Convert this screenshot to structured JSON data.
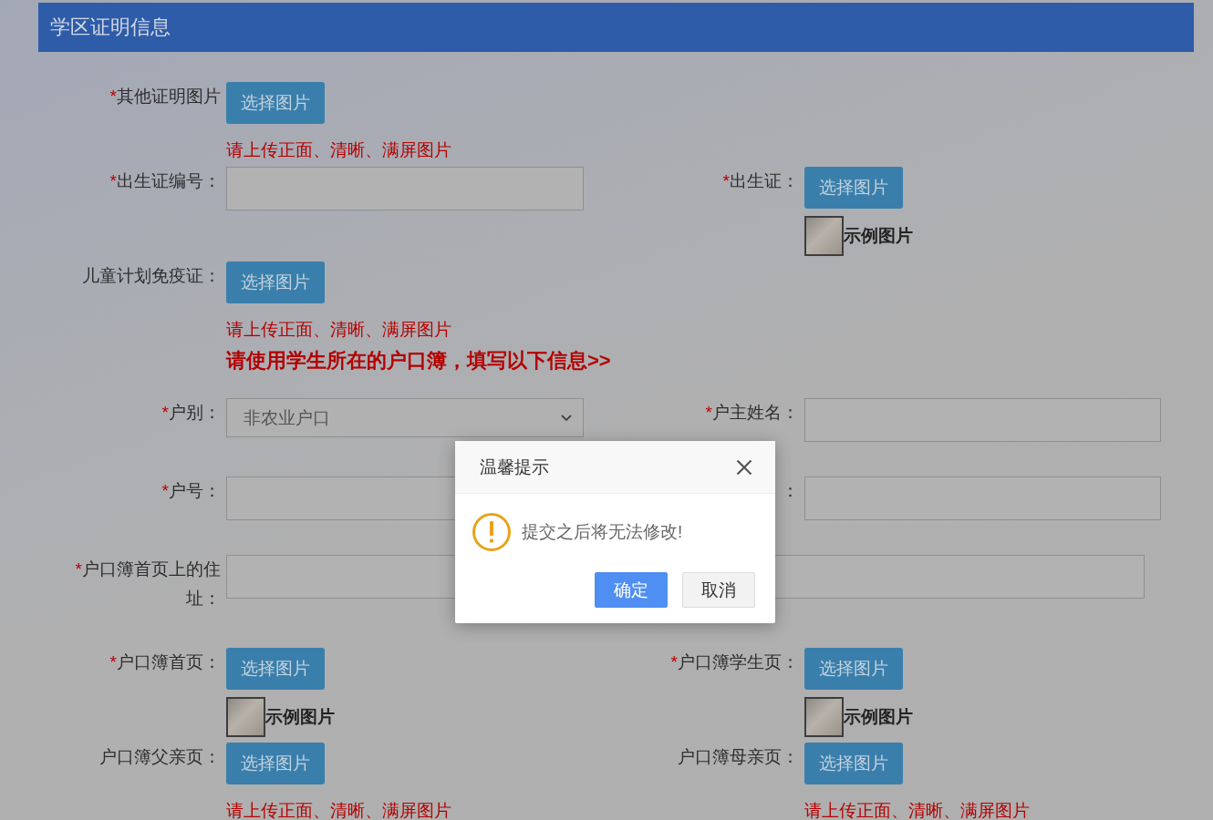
{
  "section": {
    "title": "学区证明信息"
  },
  "rows": [
    {
      "kind": "fields",
      "cells": [
        {
          "kind": "upload",
          "required_mark": "*",
          "label": "其他证明图片",
          "button": "选择图片",
          "hint": "请上传正面、清晰、满屏图片"
        }
      ]
    },
    {
      "kind": "fields",
      "cells": [
        {
          "kind": "text",
          "required_mark": "*",
          "label": "出生证编号："
        },
        {
          "kind": "upload",
          "required_mark": "*",
          "label": "出生证：",
          "button": "选择图片",
          "sample": "示例图片"
        }
      ]
    },
    {
      "kind": "fields",
      "cells": [
        {
          "kind": "upload",
          "label": "儿童计划免疫证：",
          "button": "选择图片",
          "hint": "请上传正面、清晰、满屏图片"
        }
      ]
    },
    {
      "kind": "notice",
      "text": "请使用学生所在的户口簿，填写以下信息>>"
    },
    {
      "kind": "fields",
      "cells": [
        {
          "kind": "select",
          "required_mark": "*",
          "label": "户别：",
          "value": "非农业户口"
        },
        {
          "kind": "text",
          "required_mark": "*",
          "label": "户主姓名："
        }
      ]
    },
    {
      "kind": "fields",
      "cells": [
        {
          "kind": "text",
          "required_mark": "*",
          "label": "户号："
        },
        {
          "kind": "text",
          "label": "："
        }
      ]
    },
    {
      "kind": "fields",
      "cells": [
        {
          "kind": "text",
          "required_mark": "*",
          "label": "户口簿首页上的住址："
        }
      ]
    },
    {
      "kind": "fields",
      "cells": [
        {
          "kind": "upload",
          "required_mark": "*",
          "label": "户口簿首页：",
          "button": "选择图片",
          "sample": "示例图片"
        },
        {
          "kind": "upload",
          "required_mark": "*",
          "label": "户口簿学生页：",
          "button": "选择图片",
          "sample": "示例图片"
        }
      ]
    },
    {
      "kind": "fields",
      "cells": [
        {
          "kind": "upload",
          "label": "户口簿父亲页：",
          "button": "选择图片",
          "hint": "请上传正面、清晰、满屏图片"
        },
        {
          "kind": "upload",
          "label": "户口簿母亲页：",
          "button": "选择图片",
          "hint": "请上传正面、清晰、满屏图片"
        }
      ]
    }
  ],
  "dialog": {
    "title": "温馨提示",
    "message": "提交之后将无法修改!",
    "buttons": [
      {
        "kind": "primary",
        "label": "确定"
      },
      {
        "kind": "default",
        "label": "取消"
      }
    ]
  }
}
